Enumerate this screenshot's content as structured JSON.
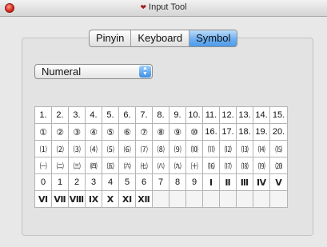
{
  "window": {
    "title": "Input Tool",
    "icons": {
      "close": "close-button-red",
      "app": "input-tool-icon"
    }
  },
  "tabs": [
    {
      "label": "Pinyin",
      "selected": false
    },
    {
      "label": "Keyboard",
      "selected": false
    },
    {
      "label": "Symbol",
      "selected": true
    }
  ],
  "category_select": {
    "value": "Numeral"
  },
  "symbols": {
    "rows": [
      [
        "1.",
        "2.",
        "3.",
        "4.",
        "5.",
        "6.",
        "7.",
        "8.",
        "9.",
        "10.",
        "11.",
        "12.",
        "13.",
        "14.",
        "15."
      ],
      [
        "①",
        "②",
        "③",
        "④",
        "⑤",
        "⑥",
        "⑦",
        "⑧",
        "⑨",
        "⑩",
        "16.",
        "17.",
        "18.",
        "19.",
        "20."
      ],
      [
        "⑴",
        "⑵",
        "⑶",
        "⑷",
        "⑸",
        "⑹",
        "⑺",
        "⑻",
        "⑼",
        "⑽",
        "⑾",
        "⑿",
        "⒀",
        "⒁",
        "⒂"
      ],
      [
        "㈠",
        "㈡",
        "㈢",
        "㈣",
        "㈤",
        "㈥",
        "㈦",
        "㈧",
        "㈨",
        "㈩",
        "⒃",
        "⒄",
        "⒅",
        "⒆",
        "⒇"
      ],
      [
        "0",
        "1",
        "2",
        "3",
        "4",
        "5",
        "6",
        "7",
        "8",
        "9",
        "Ⅰ",
        "Ⅱ",
        "Ⅲ",
        "Ⅳ",
        "Ⅴ"
      ],
      [
        "Ⅵ",
        "Ⅶ",
        "Ⅷ",
        "Ⅸ",
        "Ⅹ",
        "Ⅺ",
        "Ⅻ",
        "",
        "",
        "",
        "",
        "",
        "",
        "",
        ""
      ]
    ]
  },
  "colors": {
    "selected_tab": "#6eb0f2",
    "close_button": "#d6271c",
    "grid_border": "#b4b4b4"
  }
}
